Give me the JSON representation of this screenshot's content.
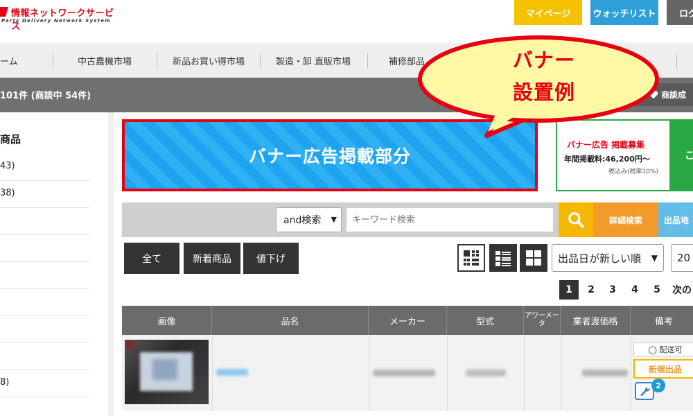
{
  "header": {
    "logo_title": "情報ネットワークサービス",
    "logo_subtitle": "Parts Delivery Network System",
    "mypage_label": "マイページ",
    "watchlist_label": "ウォッチリスト",
    "login_label": "ログ"
  },
  "nav": {
    "items": [
      "ーム",
      "中古農機市場",
      "新品お買い得市場",
      "製造・卸 直販市場",
      "補修部品"
    ]
  },
  "countbar": {
    "text": "101件 (商談中 54件)",
    "deal_button": "商談成"
  },
  "sidebar": {
    "heading": "商品",
    "rows": [
      "43)",
      "38)",
      "",
      "",
      "",
      "",
      "",
      "",
      "8)",
      ""
    ]
  },
  "banner": {
    "text": "バナー広告掲載部分"
  },
  "ad": {
    "title": "バナー広告 掲載募集",
    "fee": "年間掲載料:46,200円〜",
    "tax": "税込み(税率10%)",
    "cta": "こ"
  },
  "callout": {
    "line1": "バナー",
    "line2": "設置例"
  },
  "search": {
    "mode_selected": "and検索",
    "keyword_placeholder": "キーワード検索",
    "detail_label": "詳細検索",
    "location_label": "出品地"
  },
  "filters": {
    "all_label": "全て",
    "new_label": "新着商品",
    "price_down_label": "値下げ",
    "sort_selected": "出品日が新しい順",
    "per_page_selected": "20"
  },
  "pagination": {
    "pages": [
      "1",
      "2",
      "3",
      "4",
      "5"
    ],
    "current": "1",
    "next_label": "次の"
  },
  "table": {
    "headers": {
      "image": "画像",
      "name": "品名",
      "maker": "メーカー",
      "model": "型式",
      "power": "アワーメータ",
      "price": "業者渡価格",
      "notes": "備考"
    },
    "row": {
      "delivery": "◯ 配送可",
      "new_tag": "新規出品",
      "badge_count": "2"
    }
  },
  "colors": {
    "brand_red": "#e60012",
    "mypage_yellow": "#f5c200",
    "watch_blue": "#2f9fd8",
    "search_yellow": "#f5b700",
    "detail_orange": "#f39a2c"
  }
}
